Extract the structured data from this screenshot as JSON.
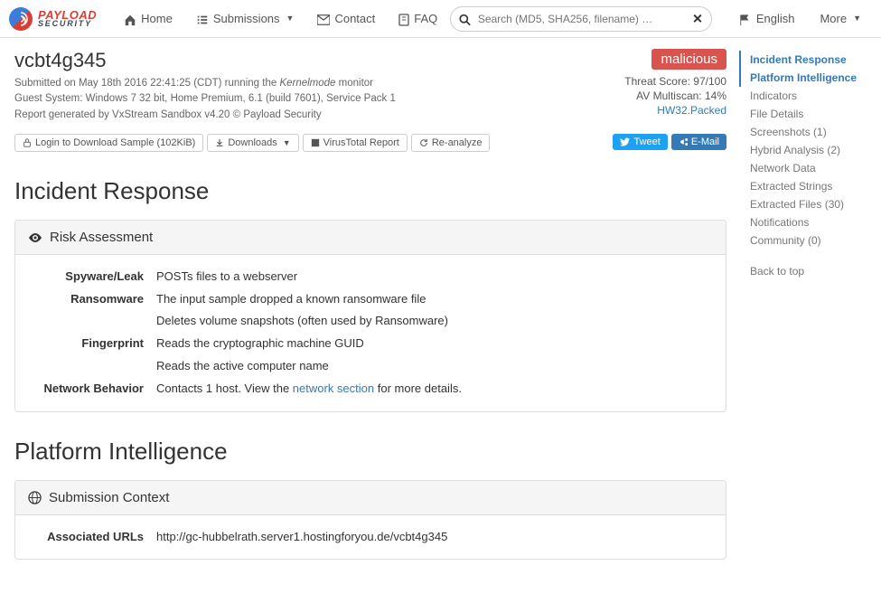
{
  "nav": {
    "home": "Home",
    "submissions": "Submissions",
    "contact": "Contact",
    "faq": "FAQ",
    "english": "English",
    "more": "More"
  },
  "search": {
    "placeholder": "Search (MD5, SHA256, filename) …"
  },
  "logo": {
    "top": "PAYLOAD",
    "bot": "SECURITY"
  },
  "sample": {
    "name": "vcbt4g345",
    "submitted_prefix": "Submitted on May 18th 2016 22:41:25 (CDT) running the ",
    "submitted_mode": "Kernelmode",
    "submitted_suffix": " monitor",
    "guest": "Guest System: Windows 7 32 bit, Home Premium, 6.1 (build 7601), Service Pack 1",
    "report": "Report generated by VxStream Sandbox v4.20 © Payload Security"
  },
  "verdict": {
    "label": "malicious",
    "threat_score": "Threat Score: 97/100",
    "av_multiscan": "AV Multiscan: 14%",
    "detection": "HW32.Packed"
  },
  "actions": {
    "login_download": "Login to Download Sample (102KiB)",
    "downloads": "Downloads",
    "vt_report": "VirusTotal Report",
    "reanalyze": "Re-analyze",
    "tweet": "Tweet",
    "email": "E-Mail"
  },
  "sections": {
    "incident_response": "Incident Response",
    "platform_intelligence": "Platform Intelligence"
  },
  "risk": {
    "heading": "Risk Assessment",
    "rows": [
      {
        "k": "Spyware/Leak",
        "v": "POSTs files to a webserver"
      },
      {
        "k": "Ransomware",
        "v": "The input sample dropped a known ransomware file"
      },
      {
        "k": "",
        "v": "Deletes volume snapshots (often used by Ransomware)"
      },
      {
        "k": "Fingerprint",
        "v": "Reads the cryptographic machine GUID"
      },
      {
        "k": "",
        "v": "Reads the active computer name"
      }
    ],
    "net_key": "Network Behavior",
    "net_pre": "Contacts 1 host. View the ",
    "net_link": "network section",
    "net_post": " for more details."
  },
  "submission": {
    "heading": "Submission Context",
    "urls_key": "Associated URLs",
    "urls_val": "http://gc-hubbelrath.server1.hostingforyou.de/vcbt4g345"
  },
  "sidebar": {
    "items": [
      "Incident Response",
      "Platform Intelligence",
      "Indicators",
      "File Details",
      "Screenshots (1)",
      "Hybrid Analysis (2)",
      "Network Data",
      "Extracted Strings",
      "Extracted Files (30)",
      "Notifications",
      "Community (0)"
    ],
    "back": "Back to top"
  }
}
